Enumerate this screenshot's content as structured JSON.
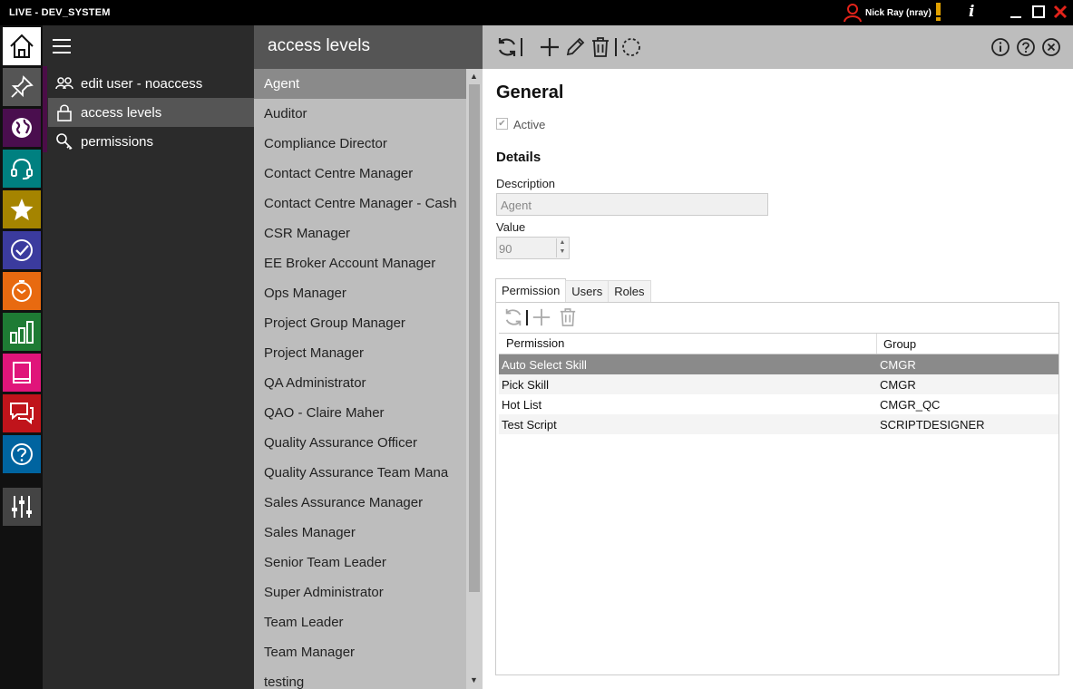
{
  "titlebar": {
    "app_title": "LIVE - DEV_SYSTEM",
    "user": "Nick Ray (nray)"
  },
  "rail": {
    "items": [
      {
        "icon": "home-icon",
        "color": "#ffffff"
      },
      {
        "icon": "pin-icon",
        "color": "#555555"
      },
      {
        "icon": "globe-icon",
        "color": "#4a0e4e"
      },
      {
        "icon": "headset-icon",
        "color": "#008080"
      },
      {
        "icon": "star-icon",
        "color": "#a58400"
      },
      {
        "icon": "check-circle-icon",
        "color": "#3b3b9e"
      },
      {
        "icon": "timer-icon",
        "color": "#e86a10"
      },
      {
        "icon": "bar-chart-icon",
        "color": "#1e7b34"
      },
      {
        "icon": "book-icon",
        "color": "#e0157a"
      },
      {
        "icon": "chat-icon",
        "color": "#c0141b"
      },
      {
        "icon": "help-icon",
        "color": "#0064a0"
      },
      {
        "icon": "settings-sliders-icon",
        "color": "#444444"
      }
    ]
  },
  "subnav": {
    "items": [
      {
        "label": "edit user - noaccess",
        "icon": "users-icon"
      },
      {
        "label": "access levels",
        "icon": "lock-icon"
      },
      {
        "label": "permissions",
        "icon": "key-icon"
      }
    ]
  },
  "list": {
    "header": "access levels",
    "items": [
      "Agent",
      "Auditor",
      "Compliance Director",
      "Contact Centre Manager",
      "Contact Centre Manager - Cash",
      "CSR Manager",
      "EE Broker Account Manager",
      "Ops Manager",
      "Project Group Manager",
      "Project Manager",
      "QA Administrator",
      "QAO - Claire Maher",
      "Quality Assurance Officer",
      "Quality Assurance Team Mana",
      "Sales Assurance Manager",
      "Sales Manager",
      "Senior Team Leader",
      "Super Administrator",
      "Team Leader",
      "Team Manager",
      "testing"
    ]
  },
  "detail": {
    "general_heading": "General",
    "active_label": "Active",
    "details_heading": "Details",
    "description_label": "Description",
    "description_value": "Agent",
    "value_label": "Value",
    "value_value": "90",
    "tabs": [
      "Permission",
      "Users",
      "Roles"
    ],
    "grid": {
      "headers": [
        "Permission",
        "Group"
      ],
      "rows": [
        [
          "Auto Select Skill",
          "CMGR"
        ],
        [
          "Pick Skill",
          "CMGR"
        ],
        [
          "Hot List",
          "CMGR_QC"
        ],
        [
          "Test Script",
          "SCRIPTDESIGNER"
        ]
      ]
    }
  }
}
